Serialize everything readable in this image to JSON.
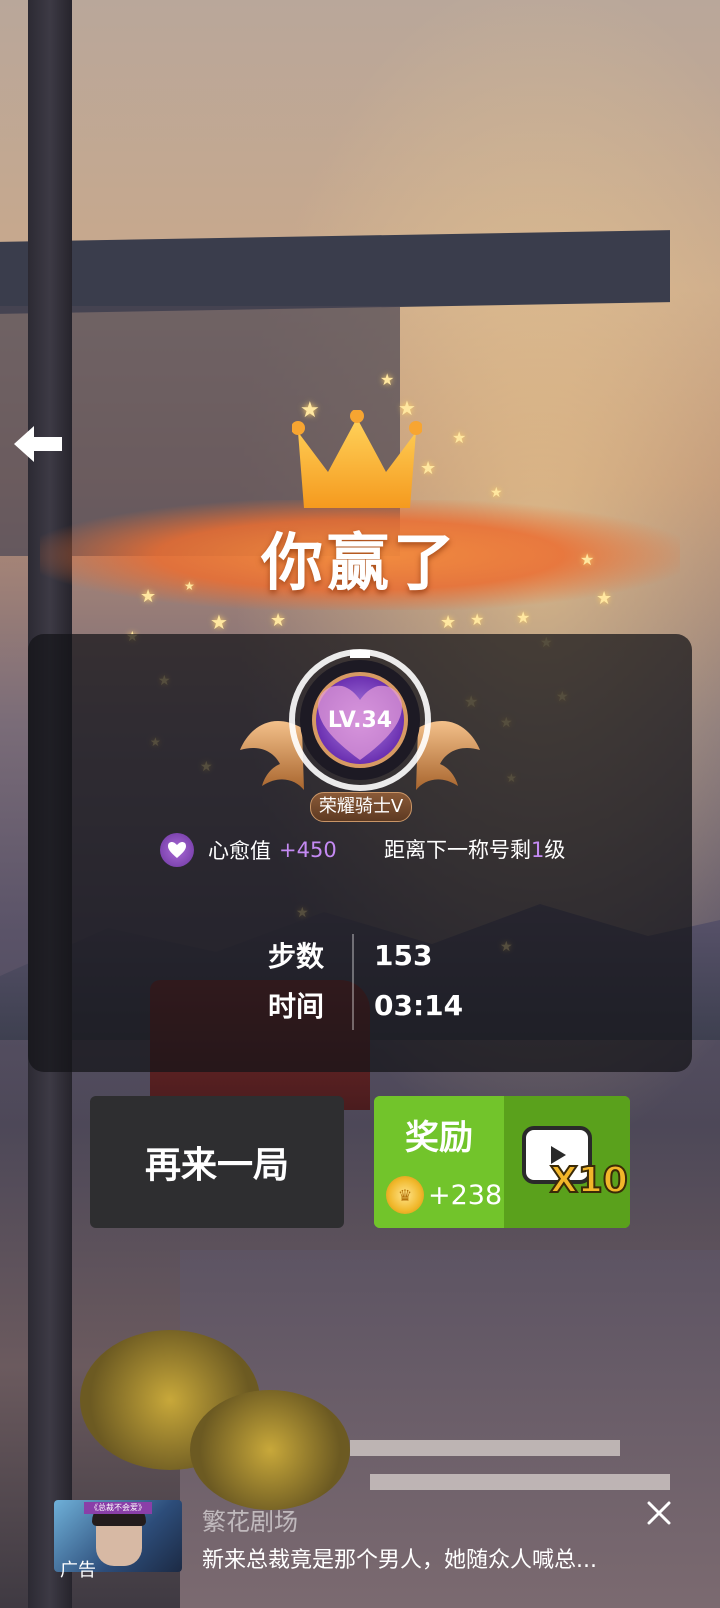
{
  "nav": {
    "back_icon": "back-arrow-icon"
  },
  "result": {
    "title": "你赢了",
    "crown_icon": "crown-icon"
  },
  "player": {
    "level": "LV.34",
    "rank_title": "荣耀骑士V",
    "heal_label": "心愈值",
    "heal_gain": "+450",
    "next_rank_prefix": "距离下一称号剩",
    "next_rank_levels": "1",
    "next_rank_suffix": "级"
  },
  "stats": [
    {
      "label": "步数",
      "value": "153"
    },
    {
      "label": "时间",
      "value": "03:14"
    }
  ],
  "actions": {
    "replay_label": "再来一局",
    "reward_title": "奖励",
    "reward_coins": "+238",
    "multiplier": "X10",
    "video_icon": "play-video-icon"
  },
  "ad": {
    "thumb_tag": "《总裁不会爱》",
    "label": "广告",
    "title": "繁花剧场",
    "text": "新来总裁竟是那个男人，她随众人喊总..."
  },
  "colors": {
    "banner": "#ef8a45",
    "reward_green": "#69b822",
    "accent_purple": "#c48af3",
    "gold": "#f2b62a"
  }
}
